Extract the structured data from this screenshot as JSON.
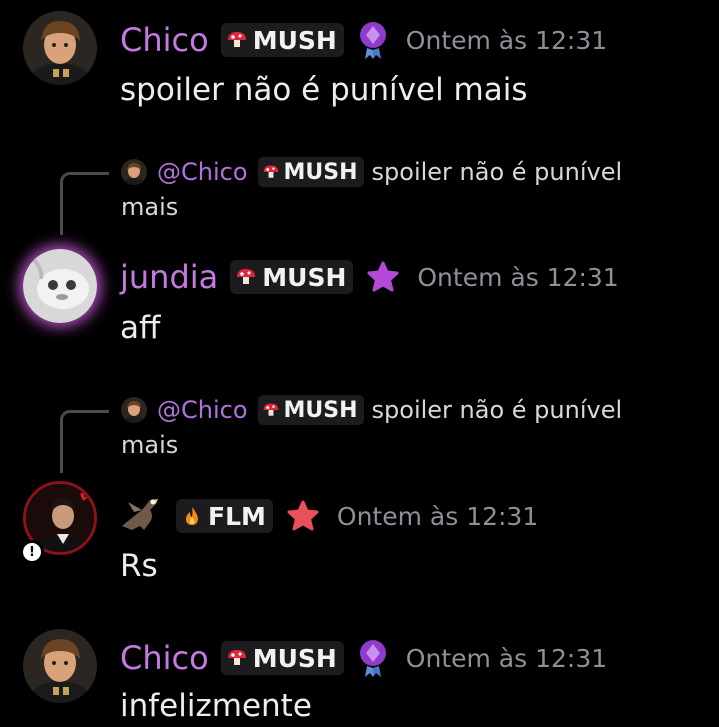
{
  "messages": [
    {
      "author": "Chico",
      "author_color": "#c57ae2",
      "tag": "MUSH",
      "time": "Ontem às 12:31",
      "text": "spoiler não é punível mais",
      "badge": "purple-gem-badge"
    },
    {
      "reply": {
        "mention": "@Chico",
        "tag": "MUSH",
        "text": "spoiler não é punível",
        "text2": "mais"
      },
      "author": "jundia",
      "author_color": "#c57ae2",
      "tag": "MUSH",
      "time": "Ontem às 12:31",
      "text": "aff",
      "badge": "purple-star-badge"
    },
    {
      "reply": {
        "mention": "@Chico",
        "tag": "MUSH",
        "text": "spoiler não é punível",
        "text2": "mais"
      },
      "author": "",
      "tag": "FLM",
      "time": "Ontem às 12:31",
      "text": "Rs",
      "badge": "red-star-badge"
    },
    {
      "author": "Chico",
      "author_color": "#c57ae2",
      "tag": "MUSH",
      "time": "Ontem às 12:31",
      "text": "infelizmente",
      "badge": "purple-gem-badge"
    }
  ]
}
